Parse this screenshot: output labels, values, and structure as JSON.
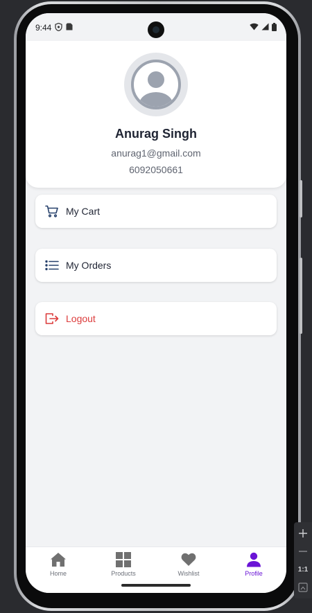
{
  "status_bar": {
    "time": "9:44",
    "icons": [
      "shield-icon",
      "sim-icon",
      "wifi-icon",
      "signal-icon",
      "battery-icon"
    ]
  },
  "profile": {
    "name": "Anurag Singh",
    "email": "anurag1@gmail.com",
    "phone": "6092050661",
    "avatar_icon": "user-avatar-icon"
  },
  "menu": {
    "cart_label": "My Cart",
    "orders_label": "My Orders",
    "logout_label": "Logout",
    "icons": {
      "cart": "cart-icon",
      "orders": "list-icon",
      "logout": "logout-icon"
    }
  },
  "bottom_nav": {
    "items": [
      {
        "label": "Home",
        "icon": "home-icon"
      },
      {
        "label": "Products",
        "icon": "grid-icon"
      },
      {
        "label": "Wishlist",
        "icon": "heart-icon"
      },
      {
        "label": "Profile",
        "icon": "person-icon"
      }
    ],
    "active": "Profile"
  },
  "emulator_toolbar": {
    "zoom_in": "+",
    "zoom_out": "−",
    "ratio": "1:1"
  },
  "colors": {
    "accent": "#6a14d6",
    "danger": "#dc3b3b",
    "icon_blue": "#26406b",
    "background": "#f2f3f5"
  }
}
